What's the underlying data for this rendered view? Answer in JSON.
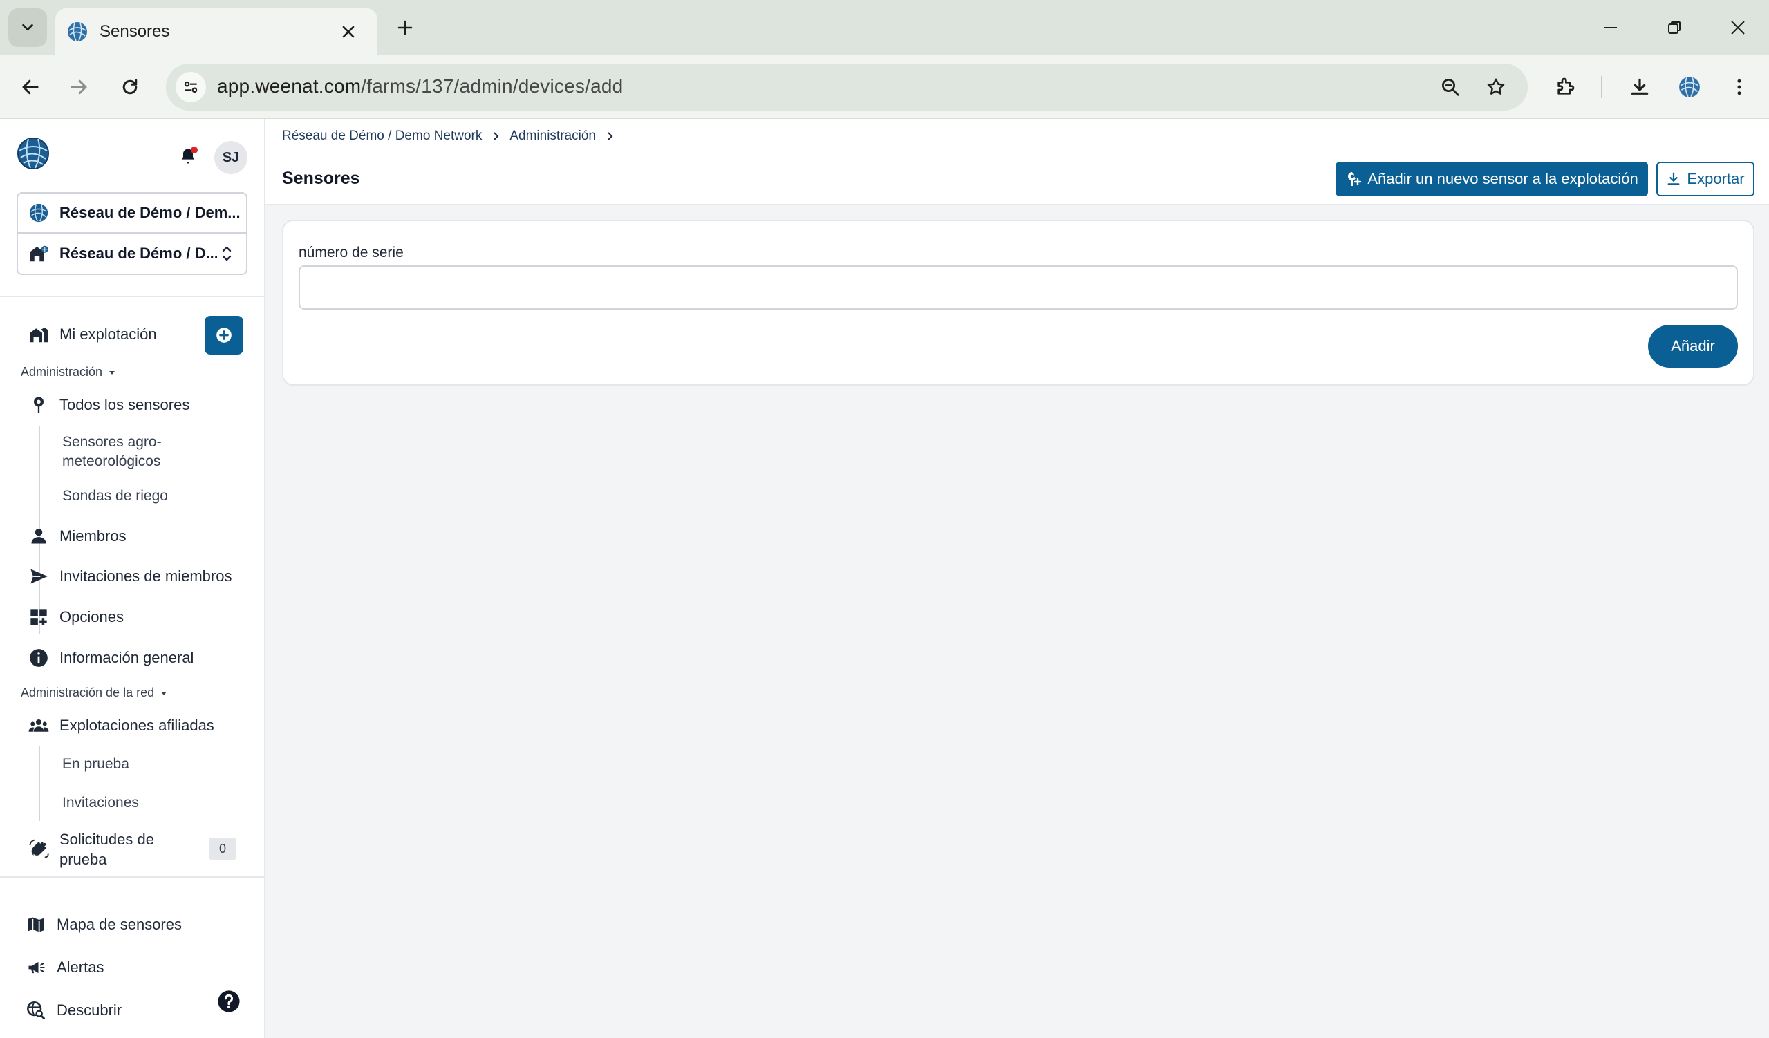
{
  "browser": {
    "tab_title": "Sensores",
    "url_host": "app.weenat.com",
    "url_path": "/farms/137/admin/devices/add"
  },
  "sidebar": {
    "user_initials": "SJ",
    "network_selector": "Réseau de Démo / Dem...",
    "farm_selector": "Réseau de Démo / D...",
    "my_farm": "Mi explotación",
    "admin_section": "Administración",
    "admin_items": {
      "all_sensors": "Todos los sensores",
      "agro_sensors": "Sensores agro-meteorológicos",
      "agro_sensors_line1": "Sensores agro-",
      "agro_sensors_line2": "meteorológicos",
      "irrigation_probes": "Sondas de riego",
      "members": "Miembros",
      "member_invitations": "Invitaciones de miembros",
      "options": "Opciones",
      "general_info": "Información general"
    },
    "network_admin_section": "Administración de la red",
    "network_items": {
      "affiliated_farms": "Explotaciones afiliadas",
      "in_trial": "En prueba",
      "invitations": "Invitaciones",
      "trial_requests_line1": "Solicitudes de",
      "trial_requests_line2": "prueba",
      "trial_requests_count": "0"
    },
    "bottom_items": {
      "sensor_map": "Mapa de sensores",
      "alerts": "Alertas",
      "discover": "Descubrir"
    }
  },
  "main": {
    "breadcrumb": [
      "Réseau de Démo / Demo Network",
      "Administración"
    ],
    "page_title": "Sensores",
    "add_sensor_button": "Añadir un nuevo sensor a la explotación",
    "export_button": "Exportar",
    "form": {
      "serial_label": "número de serie",
      "serial_value": "",
      "submit_label": "Añadir"
    }
  },
  "colors": {
    "primary": "#0a5f94",
    "chrome_bg": "#dde4dd",
    "page_bg": "#f3f4f6"
  }
}
